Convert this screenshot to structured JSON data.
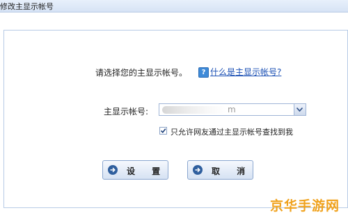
{
  "window": {
    "title": "修改主显示帐号"
  },
  "dialog": {
    "prompt": "请选择您的主显示帐号。",
    "help_link": "什么是主显示帐号?",
    "account_label": "主显示帐号:",
    "account_value_visible": "m",
    "checkbox_checked": true,
    "checkbox_label": "只允许网友通过主显示帐号查找到我",
    "set_button": "设 置",
    "cancel_button": "取 消"
  },
  "watermark": "京华手游网"
}
